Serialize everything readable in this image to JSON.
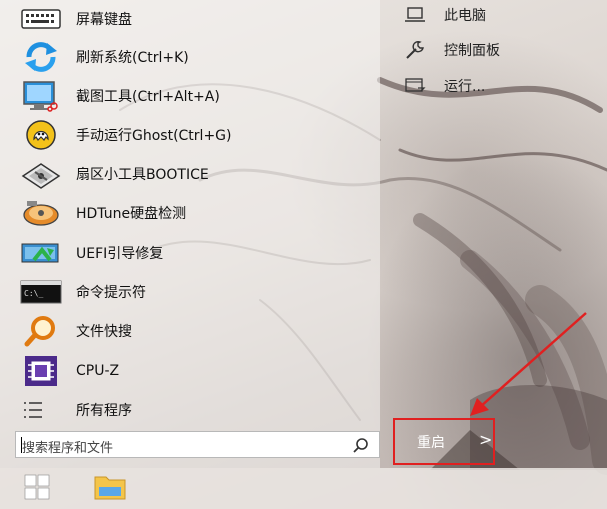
{
  "menu": {
    "items": [
      {
        "label": "屏幕键盘",
        "icon": "keyboard-icon"
      },
      {
        "label": "刷新系统(Ctrl+K)",
        "icon": "refresh-icon"
      },
      {
        "label": "截图工具(Ctrl+Alt+A)",
        "icon": "screenshot-icon"
      },
      {
        "label": "手动运行Ghost(Ctrl+G)",
        "icon": "ghost-icon"
      },
      {
        "label": "扇区小工具BOOTICE",
        "icon": "disk-tool-icon"
      },
      {
        "label": "HDTune硬盘检测",
        "icon": "hdtune-icon"
      },
      {
        "label": "UEFI引导修复",
        "icon": "uefi-repair-icon"
      },
      {
        "label": "命令提示符",
        "icon": "cmd-icon"
      },
      {
        "label": "文件快搜",
        "icon": "file-search-icon"
      },
      {
        "label": "CPU-Z",
        "icon": "cpuz-icon"
      },
      {
        "label": "所有程序",
        "icon": "all-programs-icon"
      }
    ]
  },
  "right": {
    "items": [
      {
        "label": "此电脑",
        "icon": "computer-icon"
      },
      {
        "label": "控制面板",
        "icon": "wrench-icon"
      },
      {
        "label": "运行...",
        "icon": "run-icon"
      }
    ]
  },
  "search": {
    "placeholder": "搜索程序和文件"
  },
  "power": {
    "label": "重启",
    "chevron": ">"
  },
  "colors": {
    "highlight_box": "#e02020",
    "arrow": "#e02020"
  }
}
